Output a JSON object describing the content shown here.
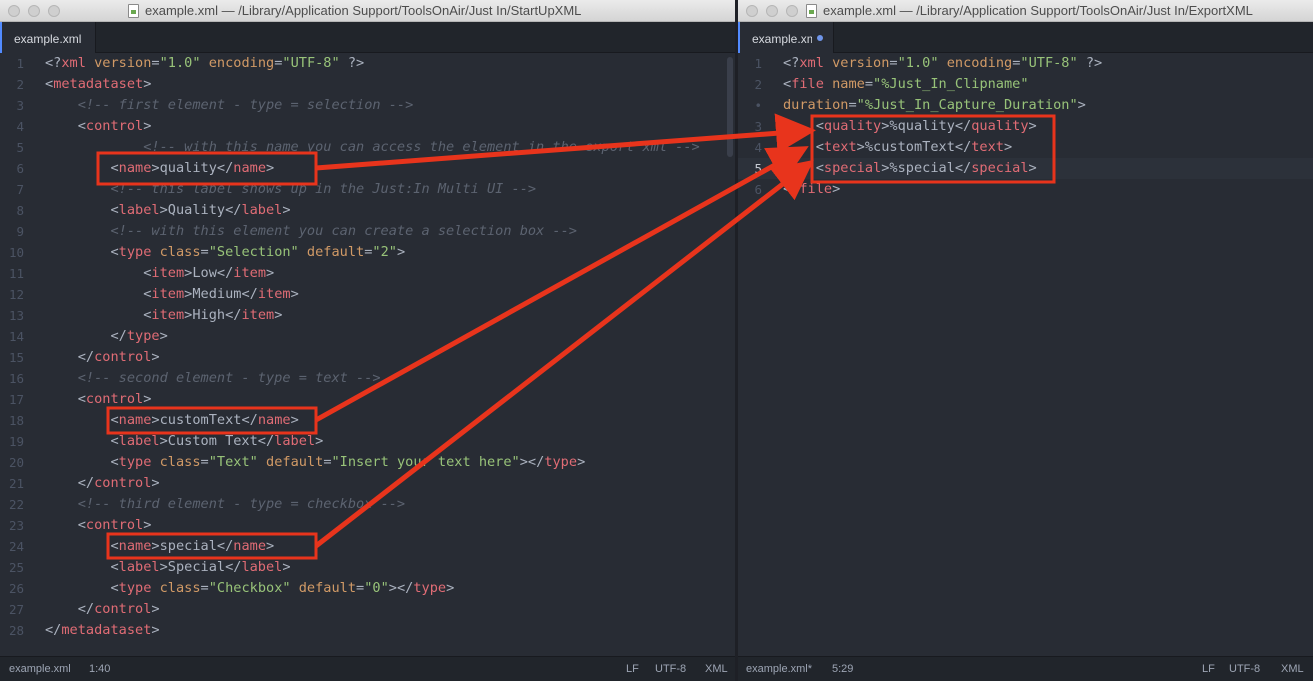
{
  "left": {
    "title": "example.xml — /Library/Application Support/ToolsOnAir/Just In/StartUpXML",
    "tab": "example.xml",
    "status": {
      "file": "example.xml",
      "cursor": "1:40",
      "eol": "LF",
      "encoding": "UTF-8",
      "grammar": "XML"
    },
    "lines": [
      {
        "n": "1",
        "tokens": [
          [
            "p",
            "<?"
          ],
          [
            "t",
            "xml"
          ],
          [
            "a",
            " version"
          ],
          [
            "p",
            "="
          ],
          [
            "s",
            "\"1.0\""
          ],
          [
            "a",
            " encoding"
          ],
          [
            "p",
            "="
          ],
          [
            "s",
            "\"UTF-8\""
          ],
          [
            "p",
            " ?>"
          ]
        ]
      },
      {
        "n": "2",
        "tokens": [
          [
            "p",
            "<"
          ],
          [
            "t",
            "metadataset"
          ],
          [
            "p",
            ">"
          ]
        ]
      },
      {
        "n": "3",
        "tokens": [
          [
            "p",
            "    "
          ],
          [
            "c",
            "<!-- first element - type = selection -->"
          ]
        ]
      },
      {
        "n": "4",
        "tokens": [
          [
            "p",
            "    <"
          ],
          [
            "t",
            "control"
          ],
          [
            "p",
            ">"
          ]
        ]
      },
      {
        "n": "5",
        "tokens": [
          [
            "p",
            "            "
          ],
          [
            "c",
            "<!-- with this name you can access the element in the export xml -->"
          ]
        ]
      },
      {
        "n": "6",
        "tokens": [
          [
            "p",
            "        <"
          ],
          [
            "t",
            "name"
          ],
          [
            "p",
            ">quality</"
          ],
          [
            "t",
            "name"
          ],
          [
            "p",
            ">"
          ]
        ]
      },
      {
        "n": "7",
        "tokens": [
          [
            "p",
            "        "
          ],
          [
            "c",
            "<!-- this label shows up in the Just:In Multi UI -->"
          ]
        ]
      },
      {
        "n": "8",
        "tokens": [
          [
            "p",
            "        <"
          ],
          [
            "t",
            "label"
          ],
          [
            "p",
            ">Quality</"
          ],
          [
            "t",
            "label"
          ],
          [
            "p",
            ">"
          ]
        ]
      },
      {
        "n": "9",
        "tokens": [
          [
            "p",
            "        "
          ],
          [
            "c",
            "<!-- with this element you can create a selection box -->"
          ]
        ]
      },
      {
        "n": "10",
        "tokens": [
          [
            "p",
            "        <"
          ],
          [
            "t",
            "type"
          ],
          [
            "a",
            " class"
          ],
          [
            "p",
            "="
          ],
          [
            "s",
            "\"Selection\""
          ],
          [
            "a",
            " default"
          ],
          [
            "p",
            "="
          ],
          [
            "s",
            "\"2\""
          ],
          [
            "p",
            ">"
          ]
        ]
      },
      {
        "n": "11",
        "tokens": [
          [
            "p",
            "            <"
          ],
          [
            "t",
            "item"
          ],
          [
            "p",
            ">Low</"
          ],
          [
            "t",
            "item"
          ],
          [
            "p",
            ">"
          ]
        ]
      },
      {
        "n": "12",
        "tokens": [
          [
            "p",
            "            <"
          ],
          [
            "t",
            "item"
          ],
          [
            "p",
            ">Medium</"
          ],
          [
            "t",
            "item"
          ],
          [
            "p",
            ">"
          ]
        ]
      },
      {
        "n": "13",
        "tokens": [
          [
            "p",
            "            <"
          ],
          [
            "t",
            "item"
          ],
          [
            "p",
            ">High</"
          ],
          [
            "t",
            "item"
          ],
          [
            "p",
            ">"
          ]
        ]
      },
      {
        "n": "14",
        "tokens": [
          [
            "p",
            "        </"
          ],
          [
            "t",
            "type"
          ],
          [
            "p",
            ">"
          ]
        ]
      },
      {
        "n": "15",
        "tokens": [
          [
            "p",
            "    </"
          ],
          [
            "t",
            "control"
          ],
          [
            "p",
            ">"
          ]
        ]
      },
      {
        "n": "16",
        "tokens": [
          [
            "p",
            "    "
          ],
          [
            "c",
            "<!-- second element - type = text -->"
          ]
        ]
      },
      {
        "n": "17",
        "tokens": [
          [
            "p",
            "    <"
          ],
          [
            "t",
            "control"
          ],
          [
            "p",
            ">"
          ]
        ]
      },
      {
        "n": "18",
        "tokens": [
          [
            "p",
            "        <"
          ],
          [
            "t",
            "name"
          ],
          [
            "p",
            ">customText</"
          ],
          [
            "t",
            "name"
          ],
          [
            "p",
            ">"
          ]
        ]
      },
      {
        "n": "19",
        "tokens": [
          [
            "p",
            "        <"
          ],
          [
            "t",
            "label"
          ],
          [
            "p",
            ">Custom Text</"
          ],
          [
            "t",
            "label"
          ],
          [
            "p",
            ">"
          ]
        ]
      },
      {
        "n": "20",
        "tokens": [
          [
            "p",
            "        <"
          ],
          [
            "t",
            "type"
          ],
          [
            "a",
            " class"
          ],
          [
            "p",
            "="
          ],
          [
            "s",
            "\"Text\""
          ],
          [
            "a",
            " default"
          ],
          [
            "p",
            "="
          ],
          [
            "s",
            "\"Insert your text here\""
          ],
          [
            "p",
            "></"
          ],
          [
            "t",
            "type"
          ],
          [
            "p",
            ">"
          ]
        ]
      },
      {
        "n": "21",
        "tokens": [
          [
            "p",
            "    </"
          ],
          [
            "t",
            "control"
          ],
          [
            "p",
            ">"
          ]
        ]
      },
      {
        "n": "22",
        "tokens": [
          [
            "p",
            "    "
          ],
          [
            "c",
            "<!-- third element - type = checkbox -->"
          ]
        ]
      },
      {
        "n": "23",
        "tokens": [
          [
            "p",
            "    <"
          ],
          [
            "t",
            "control"
          ],
          [
            "p",
            ">"
          ]
        ]
      },
      {
        "n": "24",
        "tokens": [
          [
            "p",
            "        <"
          ],
          [
            "t",
            "name"
          ],
          [
            "p",
            ">special</"
          ],
          [
            "t",
            "name"
          ],
          [
            "p",
            ">"
          ]
        ]
      },
      {
        "n": "25",
        "tokens": [
          [
            "p",
            "        <"
          ],
          [
            "t",
            "label"
          ],
          [
            "p",
            ">Special</"
          ],
          [
            "t",
            "label"
          ],
          [
            "p",
            ">"
          ]
        ]
      },
      {
        "n": "26",
        "tokens": [
          [
            "p",
            "        <"
          ],
          [
            "t",
            "type"
          ],
          [
            "a",
            " class"
          ],
          [
            "p",
            "="
          ],
          [
            "s",
            "\"Checkbox\""
          ],
          [
            "a",
            " default"
          ],
          [
            "p",
            "="
          ],
          [
            "s",
            "\"0\""
          ],
          [
            "p",
            "></"
          ],
          [
            "t",
            "type"
          ],
          [
            "p",
            ">"
          ]
        ]
      },
      {
        "n": "27",
        "tokens": [
          [
            "p",
            "    </"
          ],
          [
            "t",
            "control"
          ],
          [
            "p",
            ">"
          ]
        ]
      },
      {
        "n": "28",
        "tokens": [
          [
            "p",
            "</"
          ],
          [
            "t",
            "metadataset"
          ],
          [
            "p",
            ">"
          ]
        ]
      }
    ]
  },
  "right": {
    "title": "example.xml — /Library/Application Support/ToolsOnAir/Just In/ExportXML",
    "tab": "example.xml",
    "status": {
      "file": "example.xml*",
      "cursor": "5:29",
      "eol": "LF",
      "encoding": "UTF-8",
      "grammar": "XML"
    },
    "lines": [
      {
        "n": "1",
        "tokens": [
          [
            "p",
            "<?"
          ],
          [
            "t",
            "xml"
          ],
          [
            "a",
            " version"
          ],
          [
            "p",
            "="
          ],
          [
            "s",
            "\"1.0\""
          ],
          [
            "a",
            " encoding"
          ],
          [
            "p",
            "="
          ],
          [
            "s",
            "\"UTF-8\""
          ],
          [
            "p",
            " ?>"
          ]
        ]
      },
      {
        "n": "2",
        "tokens": [
          [
            "p",
            "<"
          ],
          [
            "t",
            "file"
          ],
          [
            "a",
            " name"
          ],
          [
            "p",
            "="
          ],
          [
            "s",
            "\"%Just_In_Clipname\""
          ]
        ]
      },
      {
        "n": "•",
        "tokens": [
          [
            "a",
            "duration"
          ],
          [
            "p",
            "="
          ],
          [
            "s",
            "\"%Just_In_Capture_Duration\""
          ],
          [
            "p",
            ">"
          ]
        ]
      },
      {
        "n": "3",
        "tokens": [
          [
            "p",
            "    <"
          ],
          [
            "t",
            "quality"
          ],
          [
            "p",
            ">%quality</"
          ],
          [
            "t",
            "quality"
          ],
          [
            "p",
            ">"
          ]
        ]
      },
      {
        "n": "4",
        "tokens": [
          [
            "p",
            "    <"
          ],
          [
            "t",
            "text"
          ],
          [
            "p",
            ">%customText</"
          ],
          [
            "t",
            "text"
          ],
          [
            "p",
            ">"
          ]
        ]
      },
      {
        "n": "5",
        "tokens": [
          [
            "p",
            "    <"
          ],
          [
            "t",
            "special"
          ],
          [
            "p",
            ">%special</"
          ],
          [
            "t",
            "special"
          ],
          [
            "p",
            ">"
          ]
        ]
      },
      {
        "n": "6",
        "tokens": [
          [
            "p",
            "</"
          ],
          [
            "t",
            "file"
          ],
          [
            "p",
            ">"
          ]
        ]
      }
    ]
  },
  "colors": {
    "annotation": "#e8341c",
    "background": "#282c34",
    "accent": "#528bff"
  }
}
